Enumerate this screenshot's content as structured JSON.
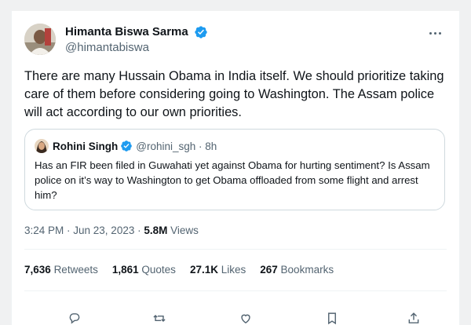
{
  "author": {
    "display_name": "Himanta Biswa Sarma",
    "handle": "@himantabiswa"
  },
  "tweet": {
    "text": "There are many Hussain Obama in India itself. We should prioritize taking care of them before considering going to Washington. The Assam police will act according to our own priorities."
  },
  "quote": {
    "display_name": "Rohini Singh",
    "handle": "@rohini_sgh · 8h",
    "text": "Has an FIR been filed in Guwahati yet against Obama for hurting sentiment? Is Assam police on it’s way to Washington to get Obama offloaded from some flight and arrest him?"
  },
  "meta": {
    "time_date": "3:24 PM · Jun 23, 2023 · ",
    "views_count": "5.8M",
    "views_label": " Views"
  },
  "stats": [
    {
      "count": "7,636",
      "label": "Retweets"
    },
    {
      "count": "1,861",
      "label": "Quotes"
    },
    {
      "count": "27.1K",
      "label": "Likes"
    },
    {
      "count": "267",
      "label": "Bookmarks"
    }
  ],
  "icons": {
    "verified": "verified-badge-icon",
    "more": "more-options-icon",
    "reply": "reply-icon",
    "retweet": "retweet-icon",
    "like": "like-icon",
    "bookmark": "bookmark-icon",
    "share": "share-icon"
  },
  "colors": {
    "verified_blue": "#1d9bf0",
    "text_primary": "#0f1419",
    "text_secondary": "#536471"
  }
}
